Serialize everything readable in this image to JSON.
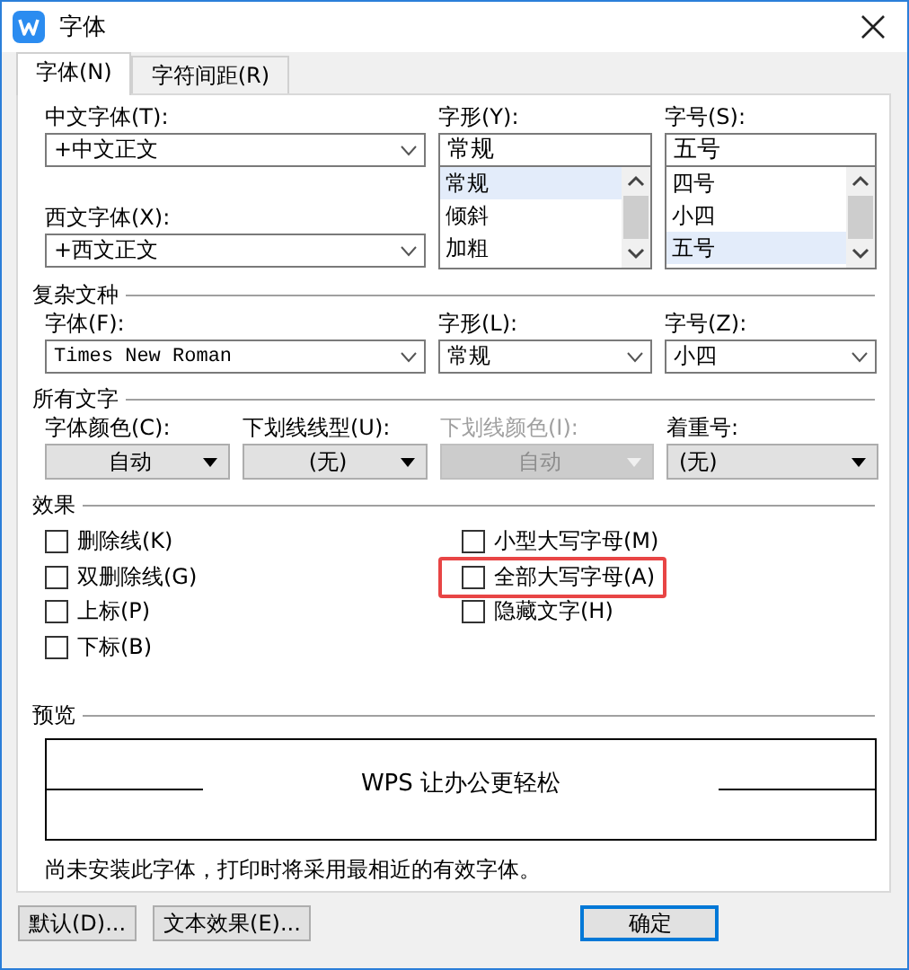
{
  "window": {
    "title": "字体"
  },
  "tabs": [
    {
      "label": "字体(N)",
      "selected": true
    },
    {
      "label": "字符间距(R)",
      "selected": false
    }
  ],
  "font": {
    "chinese_font": {
      "label": "中文字体(T):",
      "value": "+中文正文"
    },
    "western_font": {
      "label": "西文字体(X):",
      "value": "+西文正文"
    },
    "style": {
      "label": "字形(Y):",
      "value": "常规",
      "options": [
        {
          "label": "常规",
          "selected": true
        },
        {
          "label": "倾斜",
          "selected": false
        },
        {
          "label": "加粗",
          "selected": false
        }
      ]
    },
    "size": {
      "label": "字号(S):",
      "value": "五号",
      "options": [
        {
          "label": "四号",
          "selected": false
        },
        {
          "label": "小四",
          "selected": false
        },
        {
          "label": "五号",
          "selected": true
        }
      ]
    }
  },
  "complex_script": {
    "heading": "复杂文种",
    "fields": [
      {
        "label": "字体(F):",
        "value": "Times New Roman",
        "kind": "latin"
      },
      {
        "label": "字形(L):",
        "value": "常规",
        "kind": "cjk"
      },
      {
        "label": "字号(Z):",
        "value": "小四",
        "kind": "cjk"
      }
    ]
  },
  "all_text": {
    "heading": "所有文字",
    "fields": [
      {
        "label": "字体颜色(C):",
        "value": "自动",
        "disabled": false
      },
      {
        "label": "下划线线型(U):",
        "value": "(无)",
        "disabled": false
      },
      {
        "label": "下划线颜色(I):",
        "value": "自动",
        "disabled": true
      },
      {
        "label": "着重号:",
        "value": "(无)",
        "disabled": false
      }
    ]
  },
  "effects": {
    "heading": "效果",
    "columns": [
      [
        {
          "label": "删除线(K)",
          "checked": false,
          "highlighted": false
        },
        {
          "label": "双删除线(G)",
          "checked": false,
          "highlighted": false
        },
        {
          "label": "上标(P)",
          "checked": false,
          "highlighted": false
        },
        {
          "label": "下标(B)",
          "checked": false,
          "highlighted": false
        }
      ],
      [
        {
          "label": "小型大写字母(M)",
          "checked": false,
          "highlighted": false
        },
        {
          "label": "全部大写字母(A)",
          "checked": false,
          "highlighted": true
        },
        {
          "label": "隐藏文字(H)",
          "checked": false,
          "highlighted": false
        }
      ]
    ]
  },
  "preview": {
    "heading": "预览",
    "sample": "WPS 让办公更轻松",
    "note": "尚未安装此字体，打印时将采用最相近的有效字体。"
  },
  "buttons": [
    {
      "label": "默认(D)...",
      "default": false
    },
    {
      "label": "文本效果(E)...",
      "default": false
    },
    {
      "label": "确定",
      "default": true
    }
  ]
}
